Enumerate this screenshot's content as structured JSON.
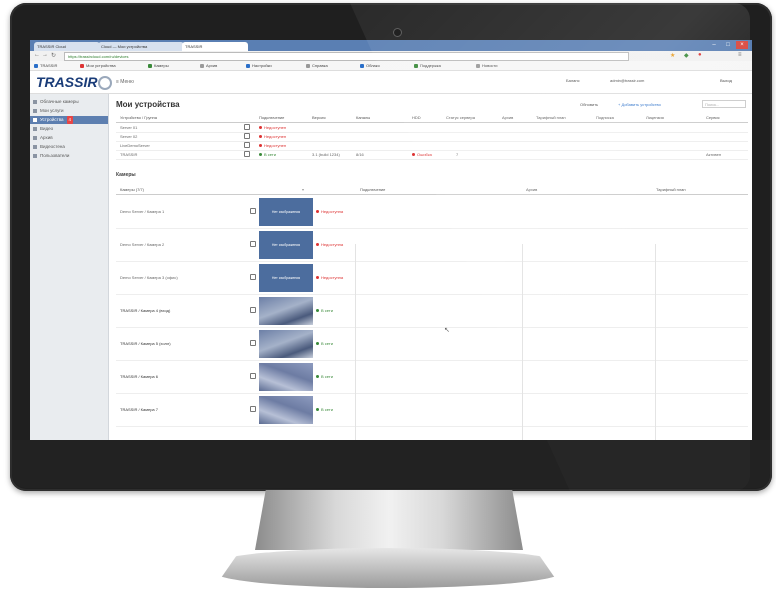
{
  "colors": {
    "sidebar_active": "#5d7fb0",
    "brand": "#1a3c78",
    "status_red": "#d33333",
    "status_green": "#3a8a3a",
    "tabbar": "#5a7fb3"
  },
  "browser": {
    "tabs": [
      {
        "label": "TRASSIR Cloud",
        "active": false
      },
      {
        "label": "Cloud — Мои устройства",
        "active": false
      },
      {
        "label": "TRASSIR",
        "active": true
      }
    ],
    "url": "https://trassircloud.com/ru/devices",
    "bookmarks": [
      "TRASSIR",
      "Мои устройства",
      "Камеры",
      "Архив",
      "Настройки",
      "Справка",
      "Облако",
      "Поддержка",
      "Новости"
    ]
  },
  "header": {
    "logo_text": "TRASSIR",
    "menu_label": "≡ Меню",
    "balance": "Баланс",
    "user": "admin@trassir.com",
    "right_link": "Выход"
  },
  "sidebar": {
    "items": [
      {
        "label": "Облачные камеры",
        "active": false
      },
      {
        "label": "Мои услуги",
        "active": false
      },
      {
        "label": "Устройства",
        "active": true,
        "badge": "4"
      },
      {
        "label": "Видео",
        "active": false
      },
      {
        "label": "Архив",
        "active": false
      },
      {
        "label": "Видеостена",
        "active": false
      },
      {
        "label": "Пользователи",
        "active": false
      }
    ]
  },
  "main": {
    "title": "Мои устройства",
    "refresh": "Обновить",
    "add_device": "+ Добавить устройство",
    "search_placeholder": "Поиск...",
    "device_table": {
      "headers": [
        "Устройство / Группа",
        "",
        "Подключение",
        "Версия",
        "Каналы",
        "HDD",
        "Статус сервера",
        "Архив",
        "Тарифный план",
        "Подписка",
        "Лицензия",
        "Сервис"
      ],
      "rows": [
        {
          "name": "Server 01",
          "status": "Недоступен",
          "status_type": "red",
          "version": "",
          "channels": "",
          "hdd_status": "",
          "archive": "",
          "service": ""
        },
        {
          "name": "Server 02",
          "status": "Недоступен",
          "status_type": "red",
          "version": "",
          "channels": "",
          "hdd_status": "",
          "archive": "",
          "service": ""
        },
        {
          "name": "LiveDemoServer",
          "status": "Недоступен",
          "status_type": "red",
          "version": "",
          "channels": "",
          "hdd_status": "",
          "archive": "",
          "service": ""
        },
        {
          "name": "TRASSIR",
          "status": "В сети",
          "status_type": "green",
          "version": "3.1 (build 1234)",
          "channels": "8/16",
          "hdd_status": "Ошибка",
          "archive": "7",
          "service": "Активен"
        }
      ]
    },
    "cameras_section": {
      "title": "Камеры",
      "filter_label": "Камеры (7/7)",
      "headers": [
        "Подключение",
        "Архив",
        "Тарифный план"
      ],
      "rows": [
        {
          "name": "Demo Server / Камера 1",
          "thumb_label": "Нет изображения",
          "status": "Недоступна",
          "status_type": "red",
          "thumb_type": "blank"
        },
        {
          "name": "Demo Server / Камера 2",
          "thumb_label": "Нет изображения",
          "status": "Недоступна",
          "status_type": "red",
          "thumb_type": "blank"
        },
        {
          "name": "Demo Server / Камера 3 (офис)",
          "thumb_label": "Нет изображения",
          "status": "Недоступна",
          "status_type": "red",
          "thumb_type": "blank"
        },
        {
          "name": "TRASSIR / Камера 4 (вход)",
          "thumb_label": "",
          "status": "В сети",
          "status_type": "green",
          "thumb_type": "img"
        },
        {
          "name": "TRASSIR / Камера 5 (холл)",
          "thumb_label": "",
          "status": "В сети",
          "status_type": "green",
          "thumb_type": "img"
        },
        {
          "name": "TRASSIR / Камера 6",
          "thumb_label": "",
          "status": "В сети",
          "status_type": "green",
          "thumb_type": "img2"
        },
        {
          "name": "TRASSIR / Камера 7",
          "thumb_label": "",
          "status": "В сети",
          "status_type": "green",
          "thumb_type": "img2"
        }
      ]
    }
  }
}
